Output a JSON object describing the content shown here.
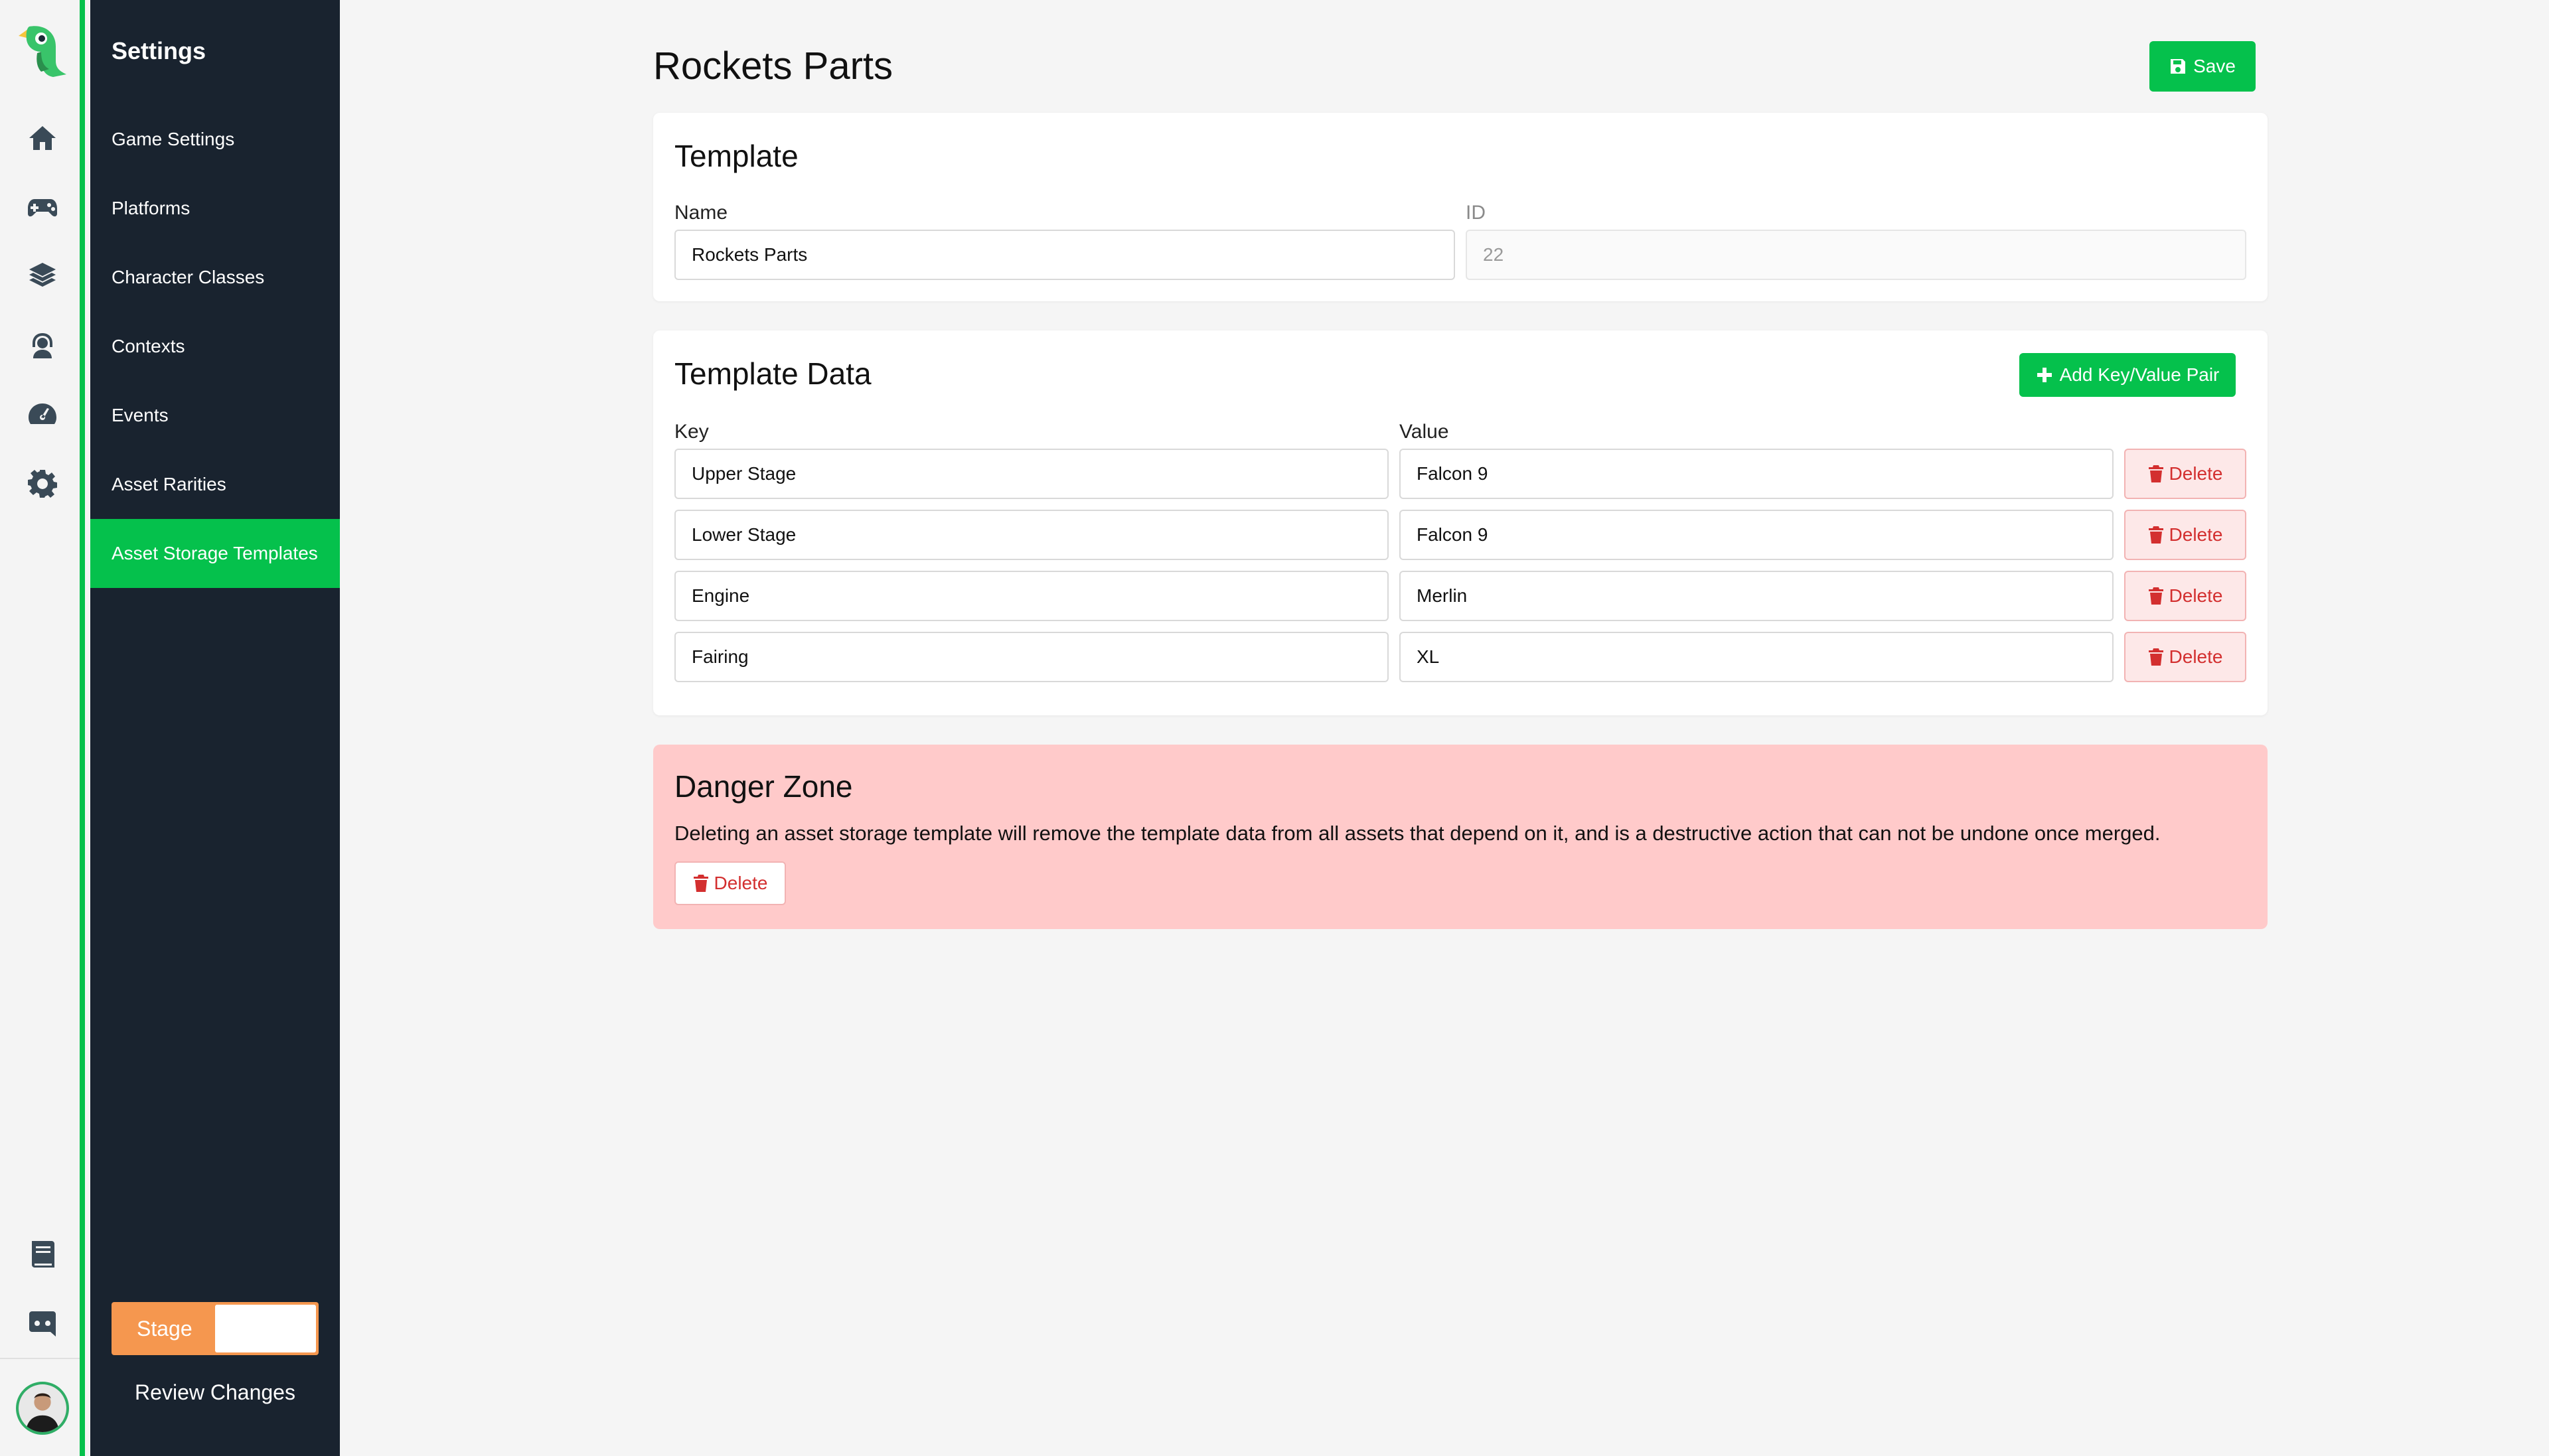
{
  "sidebar": {
    "title": "Settings",
    "items": [
      {
        "label": "Game Settings"
      },
      {
        "label": "Platforms"
      },
      {
        "label": "Character Classes"
      },
      {
        "label": "Contexts"
      },
      {
        "label": "Events"
      },
      {
        "label": "Asset Rarities"
      },
      {
        "label": "Asset Storage Templates",
        "active": true
      }
    ],
    "stage_label": "Stage",
    "review_label": "Review Changes"
  },
  "rail": {
    "icons": [
      "home-icon",
      "gamepad-icon",
      "layers-icon",
      "user-support-icon",
      "dashboard-icon",
      "gear-icon",
      "book-icon",
      "discord-icon"
    ]
  },
  "header": {
    "title": "Rockets Parts",
    "save_label": "Save"
  },
  "template": {
    "heading": "Template",
    "name_label": "Name",
    "name_value": "Rockets Parts",
    "id_label": "ID",
    "id_value": "22"
  },
  "template_data": {
    "heading": "Template Data",
    "add_label": "Add Key/Value Pair",
    "key_header": "Key",
    "value_header": "Value",
    "delete_label": "Delete",
    "rows": [
      {
        "key": "Upper Stage",
        "value": "Falcon 9"
      },
      {
        "key": "Lower Stage",
        "value": "Falcon 9"
      },
      {
        "key": "Engine",
        "value": "Merlin"
      },
      {
        "key": "Fairing",
        "value": "XL"
      }
    ]
  },
  "danger": {
    "heading": "Danger Zone",
    "text": "Deleting an asset storage template will remove the template data from all assets that depend on it, and is a destructive action that can not be undone once merged.",
    "delete_label": "Delete"
  },
  "colors": {
    "accent": "#05c14c",
    "sidebar_bg": "#19232f",
    "stage": "#f5974f",
    "danger_bg": "#ffcaca",
    "danger_text": "#d32f2f"
  }
}
